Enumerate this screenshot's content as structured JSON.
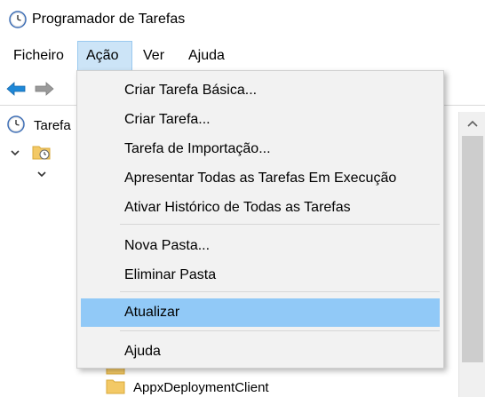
{
  "window": {
    "title": "Programador de Tarefas"
  },
  "menubar": {
    "items": [
      "Ficheiro",
      "Ação",
      "Ver",
      "Ajuda"
    ],
    "active_item": "Ação"
  },
  "toolbar": {
    "back_icon": "back-arrow-icon",
    "forward_icon": "forward-arrow-icon"
  },
  "tree": {
    "root_label": "Tarefa",
    "bottom_folder_label": "AppxDeploymentClient"
  },
  "action_menu": {
    "group1": [
      "Criar Tarefa Básica...",
      "Criar Tarefa...",
      "Tarefa de Importação...",
      "Apresentar Todas as Tarefas Em Execução",
      "Ativar Histórico de Todas as Tarefas"
    ],
    "group2": [
      "Nova Pasta...",
      "Eliminar Pasta"
    ],
    "group3": [
      "Atualizar"
    ],
    "group4": [
      "Ajuda"
    ],
    "highlighted_item": "Atualizar"
  },
  "colors": {
    "menu_highlight": "#91c9f7",
    "menubar_active": "#cce4f7",
    "arrow_blue": "#1e88d8"
  }
}
